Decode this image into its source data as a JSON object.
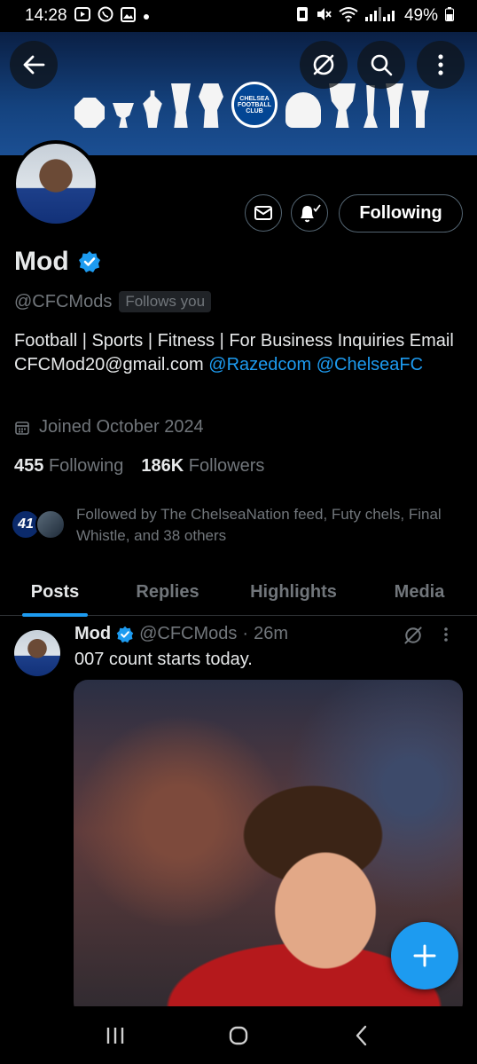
{
  "status_bar": {
    "time": "14:28",
    "battery": "49%",
    "icons_left": [
      "media-icon",
      "whatsapp-icon",
      "gallery-icon",
      "dot-icon"
    ],
    "icons_right": [
      "nfc-icon",
      "mute-icon",
      "wifi-icon",
      "signal-icon",
      "battery-icon"
    ]
  },
  "banner": {
    "crest_text": "CHELSEA FOOTBALL CLUB",
    "colors": {
      "top": "#0a1f44",
      "bottom": "#1b4f93"
    }
  },
  "header": {
    "back_icon": "arrow-left-icon",
    "grok_icon": "grok-icon",
    "search_icon": "search-icon",
    "more_icon": "more-vertical-icon"
  },
  "profile": {
    "name": "Mod",
    "handle": "@CFCMods",
    "follows_you": "Follows you",
    "bio_text": "Football | Sports | Fitness | For Business Inquiries Email CFCMod20@gmail.com",
    "bio_mention_1": "@Razedcom",
    "bio_mention_2": "@ChelseaFC",
    "joined": "Joined October 2024",
    "following_count": "455",
    "following_label": "Following",
    "followers_count": "186K",
    "followers_label": "Followers",
    "followed_by": "Followed by The ChelseaNation feed, Futy chels, Final Whistle, and 38 others",
    "mini_avatar_number": "41"
  },
  "actions": {
    "following_button": "Following"
  },
  "tabs": [
    {
      "label": "Posts",
      "active": true
    },
    {
      "label": "Replies",
      "active": false
    },
    {
      "label": "Highlights",
      "active": false
    },
    {
      "label": "Media",
      "active": false
    }
  ],
  "post": {
    "name": "Mod",
    "handle": "@CFCMods",
    "time": "26m",
    "separator": "·",
    "text": "007 count starts today."
  },
  "accent_color": "#1d9bf0"
}
